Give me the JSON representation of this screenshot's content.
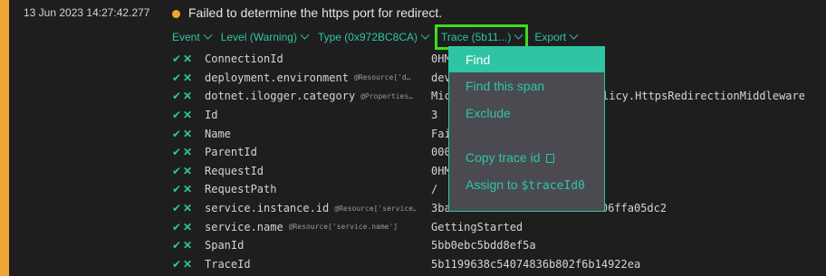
{
  "event": {
    "timestamp": "13 Jun 2023  14:27:42.277",
    "message": "Failed to determine the https port for redirect.",
    "level_color": "#f0a634"
  },
  "filters": [
    {
      "label": "Event"
    },
    {
      "label": "Level (Warning)"
    },
    {
      "label": "Type (0x972BC8CA)"
    },
    {
      "label": "Trace (5b11...)"
    },
    {
      "label": "Export"
    }
  ],
  "properties": [
    {
      "name": "ConnectionId",
      "source": "",
      "value": "0HM"
    },
    {
      "name": "deployment.environment",
      "source": "@Resource['d…",
      "value": "dev"
    },
    {
      "name": "dotnet.ilogger.category",
      "source": "@Properties…",
      "value": "Mic"
    },
    {
      "name": "Id",
      "source": "",
      "value": "3"
    },
    {
      "name": "Name",
      "source": "",
      "value": "Fai"
    },
    {
      "name": "ParentId",
      "source": "",
      "value": "000"
    },
    {
      "name": "RequestId",
      "source": "",
      "value": "0HM"
    },
    {
      "name": "RequestPath",
      "source": "",
      "value": "/"
    },
    {
      "name": "service.instance.id",
      "source": "@Resource['service…",
      "value": "3baa1a54-d177-42a1-b479-cc06ffa05dc2"
    },
    {
      "name": "service.name",
      "source": "@Resource['service.name']",
      "value": "GettingStarted"
    },
    {
      "name": "SpanId",
      "source": "",
      "value": "5bb0ebc5bdd8ef5a"
    },
    {
      "name": "TraceId",
      "source": "",
      "value": "5b1199638c54074836b802f6b14922ea"
    }
  ],
  "category_value_tail": "licy.HttpsRedirectionMiddleware",
  "trace_menu": {
    "find": "Find",
    "find_span": "Find this span",
    "exclude": "Exclude",
    "copy_trace_id": "Copy trace id",
    "assign_to": "Assign to",
    "assign_var": "$traceId0"
  },
  "colors": {
    "accent": "#2fc5a4",
    "warning": "#f0a634",
    "highlight_border": "#3ddc1f"
  }
}
